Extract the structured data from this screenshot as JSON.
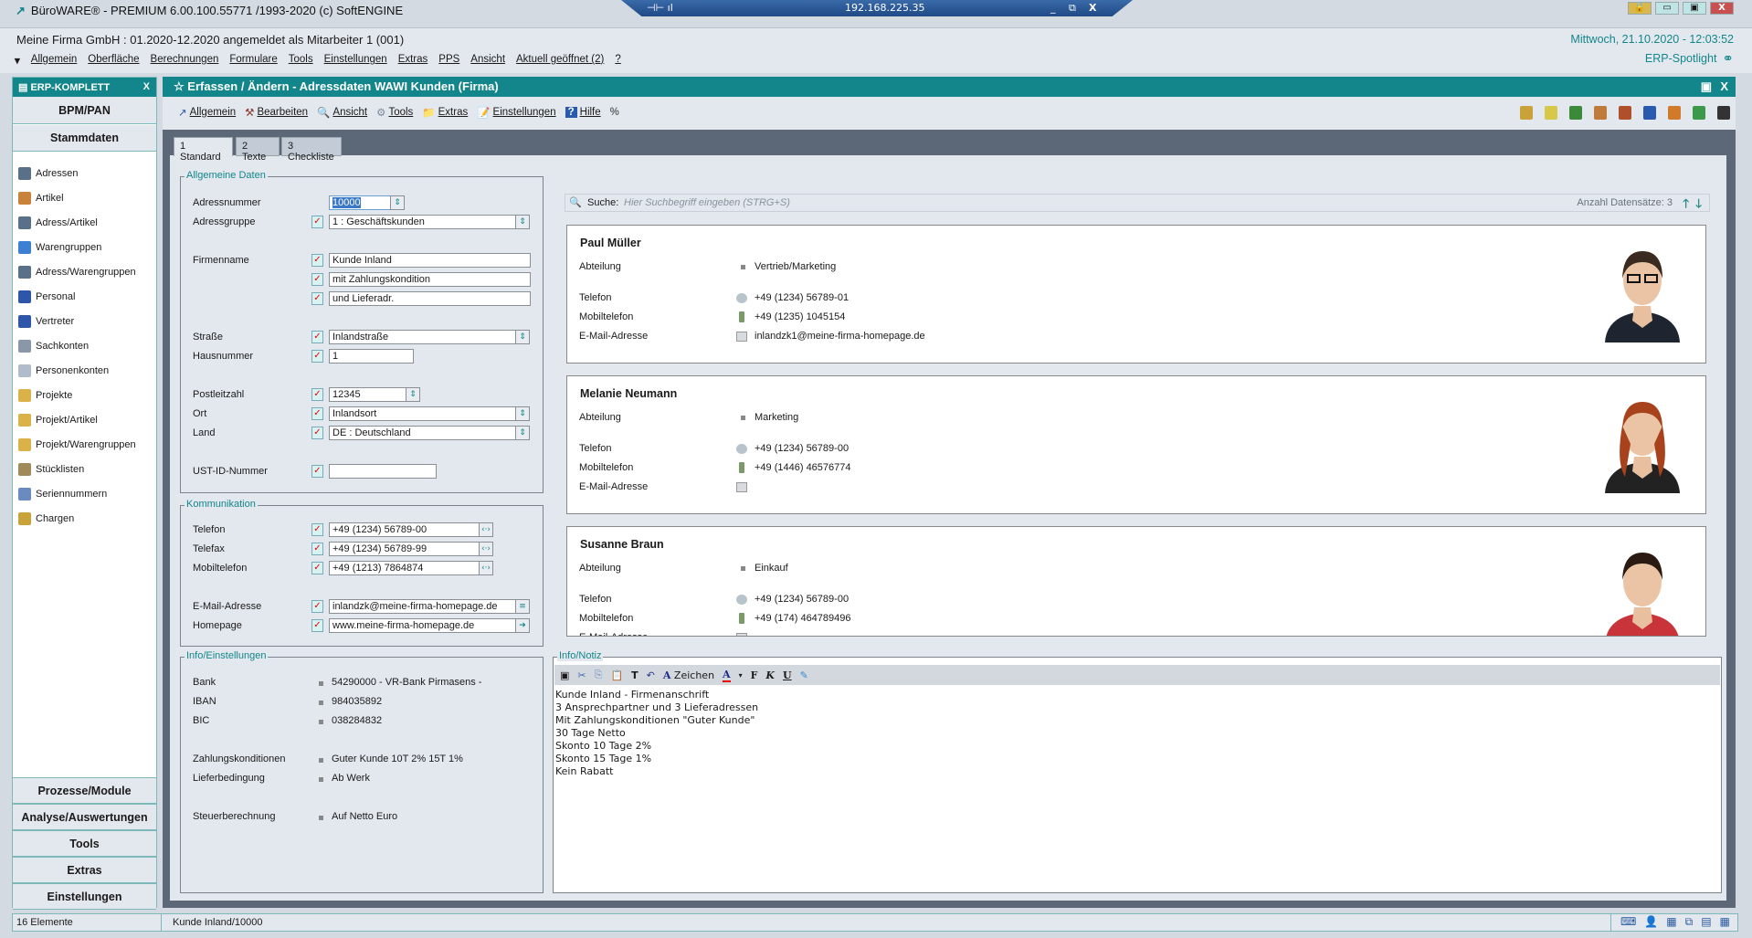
{
  "app_title": "BüroWARE® - PREMIUM  6.00.100.55771 /1993-2020 (c) SoftENGINE",
  "remote": {
    "ip": "192.168.225.35"
  },
  "header": {
    "company": "Meine Firma GmbH : 01.2020-12.2020 angemeldet als Mitarbeiter 1 (001)",
    "datetime": "Mittwoch, 21.10.2020 - 12:03:52",
    "spotlight": "ERP-Spotlight"
  },
  "menu": [
    "Allgemein",
    "Oberfläche",
    "Berechnungen",
    "Formulare",
    "Tools",
    "Einstellungen",
    "Extras",
    "PPS",
    "Ansicht",
    "Aktuell geöffnet (2)",
    "?"
  ],
  "sidebar": {
    "title": "ERP-KOMPLETT",
    "close": "X",
    "top_sections": [
      "BPM/PAN",
      "Stammdaten"
    ],
    "items": [
      {
        "label": "Adressen",
        "color": "#5a6f8a"
      },
      {
        "label": "Artikel",
        "color": "#c8823a"
      },
      {
        "label": "Adress/Artikel",
        "color": "#5a6f8a"
      },
      {
        "label": "Warengruppen",
        "color": "#3d7fd0"
      },
      {
        "label": "Adress/Warengruppen",
        "color": "#5a6f8a"
      },
      {
        "label": "Personal",
        "color": "#2d55a8"
      },
      {
        "label": "Vertreter",
        "color": "#2d55a8"
      },
      {
        "label": "Sachkonten",
        "color": "#8a97a8"
      },
      {
        "label": "Personenkonten",
        "color": "#b0bccb"
      },
      {
        "label": "Projekte",
        "color": "#d9b24a"
      },
      {
        "label": "Projekt/Artikel",
        "color": "#d9b24a"
      },
      {
        "label": "Projekt/Warengruppen",
        "color": "#d9b24a"
      },
      {
        "label": "Stücklisten",
        "color": "#a08a5a"
      },
      {
        "label": "Seriennummern",
        "color": "#6a8ac0"
      },
      {
        "label": "Chargen",
        "color": "#c9a23a"
      }
    ],
    "bottom_sections": [
      "Prozesse/Module",
      "Analyse/Auswertungen",
      "Tools",
      "Extras",
      "Einstellungen"
    ]
  },
  "window": {
    "title": "Erfassen / Ändern - Adressdaten WAWI Kunden (Firma)",
    "close": "X"
  },
  "toolbar": [
    "Allgemein",
    "Bearbeiten",
    "Ansicht",
    "Tools",
    "Extras",
    "Einstellungen",
    "Hilfe"
  ],
  "tabs": [
    "1 Standard",
    "2 Texte",
    "3 Checkliste"
  ],
  "allgemein": {
    "title": "Allgemeine Daten",
    "adressnummer_label": "Adressnummer",
    "adressnummer": "10000",
    "adressgruppe_label": "Adressgruppe",
    "adressgruppe": "1    : Geschäftskunden",
    "firmenname_label": "Firmenname",
    "firmenname": [
      "Kunde Inland",
      "mit Zahlungskondition",
      "und Lieferadr."
    ],
    "strasse_label": "Straße",
    "strasse": "Inlandstraße",
    "hausnummer_label": "Hausnummer",
    "hausnummer": "1",
    "plz_label": "Postleitzahl",
    "plz": "12345",
    "ort_label": "Ort",
    "ort": "Inlandsort",
    "land_label": "Land",
    "land": "DE    : Deutschland",
    "ust_label": "UST-ID-Nummer",
    "ust": ""
  },
  "kommunikation": {
    "title": "Kommunikation",
    "telefon_label": "Telefon",
    "telefon": "+49 (1234) 56789-00",
    "telefax_label": "Telefax",
    "telefax": "+49 (1234) 56789-99",
    "mobil_label": "Mobiltelefon",
    "mobil": "+49 (1213) 7864874",
    "email_label": "E-Mail-Adresse",
    "email": "inlandzk@meine-firma-homepage.de",
    "homepage_label": "Homepage",
    "homepage": "www.meine-firma-homepage.de"
  },
  "info": {
    "title": "Info/Einstellungen",
    "rows": [
      {
        "label": "Bank",
        "value": "54290000 - VR-Bank Pirmasens -"
      },
      {
        "label": "IBAN",
        "value": "984035892"
      },
      {
        "label": "BIC",
        "value": "038284832"
      },
      {
        "label": "Zahlungskonditionen",
        "value": "Guter Kunde 10T 2% 15T 1%"
      },
      {
        "label": "Lieferbedingung",
        "value": "Ab Werk"
      },
      {
        "label": "Steuerberechnung",
        "value": "Auf Netto Euro"
      }
    ]
  },
  "search": {
    "label": "Suche:",
    "placeholder": "Hier Suchbegriff eingeben (STRG+S)",
    "count": "Anzahl Datensätze: 3"
  },
  "contacts": [
    {
      "name": "Paul Müller",
      "abteilung_label": "Abteilung",
      "abteilung": "Vertrieb/Marketing",
      "telefon_label": "Telefon",
      "telefon": "+49 (1234) 56789-01",
      "mobil_label": "Mobiltelefon",
      "mobil": "+49 (1235) 1045154",
      "email_label": "E-Mail-Adresse",
      "email": "inlandzk1@meine-firma-homepage.de",
      "hair": "#3a2a20",
      "shirt": "#1e2430"
    },
    {
      "name": "Melanie Neumann",
      "abteilung_label": "Abteilung",
      "abteilung": "Marketing",
      "telefon_label": "Telefon",
      "telefon": "+49 (1234) 56789-00",
      "mobil_label": "Mobiltelefon",
      "mobil": "+49 (1446) 46576774",
      "email_label": "E-Mail-Adresse",
      "email": "",
      "hair": "#a8421c",
      "shirt": "#222"
    },
    {
      "name": "Susanne Braun",
      "abteilung_label": "Abteilung",
      "abteilung": "Einkauf",
      "telefon_label": "Telefon",
      "telefon": "+49 (1234) 56789-00",
      "mobil_label": "Mobiltelefon",
      "mobil": "+49 (174) 464789496",
      "email_label": "E-Mail-Adresse",
      "email": "",
      "hair": "#2a1a12",
      "shirt": "#c8343a"
    }
  ],
  "notiz": {
    "title": "Info/Notiz",
    "font_label": "Zeichen",
    "text": "Kunde Inland - Firmenanschrift\n3 Ansprechpartner und 3 Lieferadressen\nMit Zahlungskonditionen \"Guter Kunde\"\n30 Tage Netto\nSkonto 10 Tage 2%\nSkonto 15 Tage 1%\nKein Rabatt"
  },
  "status": {
    "count": "16 Elemente",
    "record": "Kunde Inland/10000"
  },
  "colors": {
    "accent": "#12868a",
    "frame": "#5c6878",
    "panel": "#e3e8ef"
  }
}
